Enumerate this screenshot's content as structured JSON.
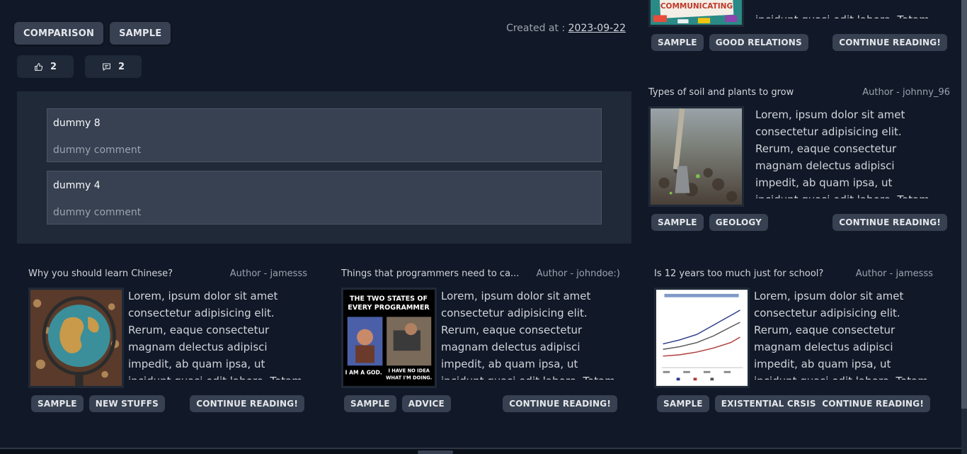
{
  "post": {
    "tags": [
      "COMPARISON",
      "SAMPLE"
    ],
    "created_label": "Created at :",
    "created_date": "2023-09-22",
    "likes": "2",
    "comments_count": "2"
  },
  "comments": [
    {
      "name": "dummy 8",
      "text": "dummy comment"
    },
    {
      "name": "dummy 4",
      "text": "dummy comment"
    }
  ],
  "excerpt": "Lorem, ipsum dolor sit amet consectetur adipisicing elit. Rerum, eaque consectetur magnam delectus adipisci impedit, ab quam ipsa, ut incidunt quasi odit labore. Totam nesciunt, quam accusamus",
  "excerpt_tail": "incidunt quasi odit labore. Totam nesciunt, quam accusamus",
  "continue_label": "CONTINUE READING!",
  "sidebar_posts": [
    {
      "tags": [
        "SAMPLE",
        "GOOD RELATIONS"
      ],
      "image": "communicating-image",
      "image_text": "COMMUNICATING"
    },
    {
      "title": "Types of soil and plants to grow",
      "author": "Author - johnny_96",
      "tags": [
        "SAMPLE",
        "GEOLOGY"
      ],
      "image": "soil-shovel-image"
    }
  ],
  "posts": [
    {
      "title": "Why you should learn Chinese?",
      "author": "Author - jamesss",
      "tags": [
        "SAMPLE",
        "NEW STUFFS"
      ],
      "image": "globe-image"
    },
    {
      "title": "Things that programmers need to ca...",
      "author": "Author - johndoe:)",
      "tags": [
        "SAMPLE",
        "ADVICE"
      ],
      "image": "programmer-meme-image",
      "meme": {
        "top": "THE TWO STATES OF",
        "top2": "EVERY PROGRAMMER",
        "left": "I AM A GOD.",
        "right1": "I HAVE NO IDEA",
        "right2": "WHAT I'M DOING."
      }
    },
    {
      "title": "Is 12 years too much just for school?",
      "author": "Author - jamesss",
      "tags": [
        "SAMPLE",
        "EXISTENTIAL CRSIS"
      ],
      "image": "line-chart-image"
    }
  ]
}
